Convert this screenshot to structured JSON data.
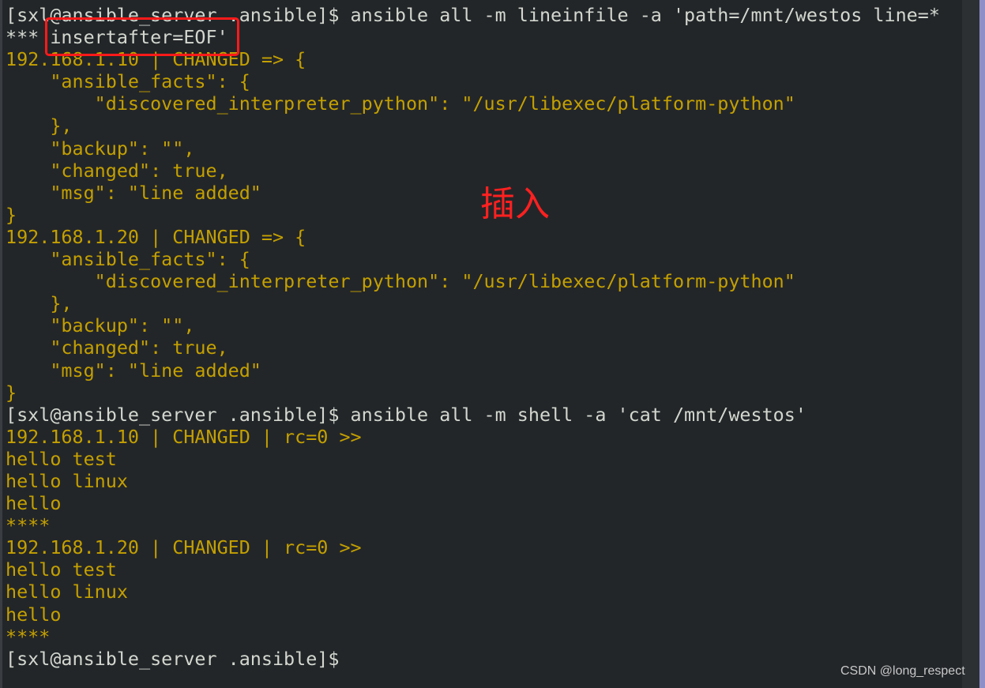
{
  "terminal": {
    "lines": [
      {
        "text": "[sxl@ansible_server .ansible]$ ansible all -m lineinfile -a 'path=/mnt/westos line=*",
        "color": "white"
      },
      {
        "text": "*** insertafter=EOF'",
        "color": "white"
      },
      {
        "text": "192.168.1.10 | CHANGED => {",
        "color": "yellow"
      },
      {
        "text": "    \"ansible_facts\": {",
        "color": "yellow"
      },
      {
        "text": "        \"discovered_interpreter_python\": \"/usr/libexec/platform-python\"",
        "color": "yellow"
      },
      {
        "text": "    },",
        "color": "yellow"
      },
      {
        "text": "    \"backup\": \"\",",
        "color": "yellow"
      },
      {
        "text": "    \"changed\": true,",
        "color": "yellow"
      },
      {
        "text": "    \"msg\": \"line added\"",
        "color": "yellow"
      },
      {
        "text": "}",
        "color": "yellow"
      },
      {
        "text": "192.168.1.20 | CHANGED => {",
        "color": "yellow"
      },
      {
        "text": "    \"ansible_facts\": {",
        "color": "yellow"
      },
      {
        "text": "        \"discovered_interpreter_python\": \"/usr/libexec/platform-python\"",
        "color": "yellow"
      },
      {
        "text": "    },",
        "color": "yellow"
      },
      {
        "text": "    \"backup\": \"\",",
        "color": "yellow"
      },
      {
        "text": "    \"changed\": true,",
        "color": "yellow"
      },
      {
        "text": "    \"msg\": \"line added\"",
        "color": "yellow"
      },
      {
        "text": "}",
        "color": "yellow"
      },
      {
        "text": "[sxl@ansible_server .ansible]$ ansible all -m shell -a 'cat /mnt/westos'",
        "color": "white"
      },
      {
        "text": "192.168.1.10 | CHANGED | rc=0 >>",
        "color": "yellow"
      },
      {
        "text": "hello test",
        "color": "yellow"
      },
      {
        "text": "hello linux",
        "color": "yellow"
      },
      {
        "text": "hello",
        "color": "yellow"
      },
      {
        "text": "****",
        "color": "yellow"
      },
      {
        "text": "192.168.1.20 | CHANGED | rc=0 >>",
        "color": "yellow"
      },
      {
        "text": "hello test",
        "color": "yellow"
      },
      {
        "text": "hello linux",
        "color": "yellow"
      },
      {
        "text": "hello",
        "color": "yellow"
      },
      {
        "text": "****",
        "color": "yellow"
      },
      {
        "text": "[sxl@ansible_server .ansible]$ ",
        "color": "white"
      }
    ]
  },
  "annotation": {
    "text": "插入",
    "color": "#ff2020"
  },
  "watermark": "CSDN @long_respect",
  "colors": {
    "background": "#232629",
    "prompt": "#d3d7cf",
    "output": "#c4a000",
    "highlight_box": "#ff1a1a"
  }
}
